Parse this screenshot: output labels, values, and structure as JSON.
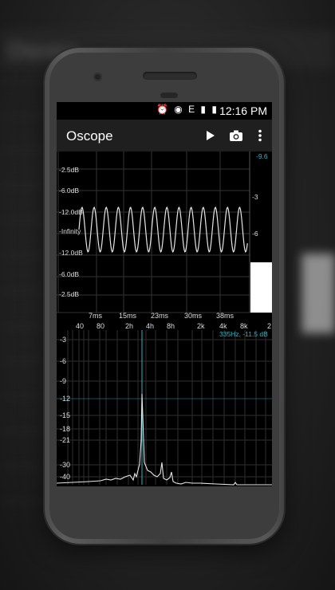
{
  "app": {
    "title": "Oscope"
  },
  "status": {
    "time": "12:16 PM",
    "icons": "⏰ ◉ E ▮ ▮"
  },
  "toolbar": {
    "play_icon": "play-icon",
    "camera_icon": "camera-icon",
    "more_icon": "more-icon"
  },
  "oscilloscope": {
    "y_labels": [
      "-2.5dB",
      "-6.0dB",
      "-12.0dB",
      "-Infinity",
      "-12.0dB",
      "-6.0dB",
      "-2.5dB"
    ],
    "x_labels": [
      "7ms",
      "15ms",
      "23ms",
      "30ms",
      "38ms"
    ],
    "level_labels": [
      "-9.6",
      "-3",
      "-6"
    ]
  },
  "spectrum": {
    "x_labels": [
      "40",
      "80",
      "2h",
      "4h",
      "8h",
      "2k",
      "4k",
      "8k",
      "2"
    ],
    "y_labels": [
      "-3",
      "-6",
      "-9",
      "-12",
      "-15",
      "-18",
      "-21",
      "-30",
      "-40"
    ],
    "peak_readout": "335Hz, -11.5 dB"
  },
  "colors": {
    "accent": "#29b6c6",
    "trace": "#e0e0e0",
    "grid": "#3a3a3a"
  }
}
